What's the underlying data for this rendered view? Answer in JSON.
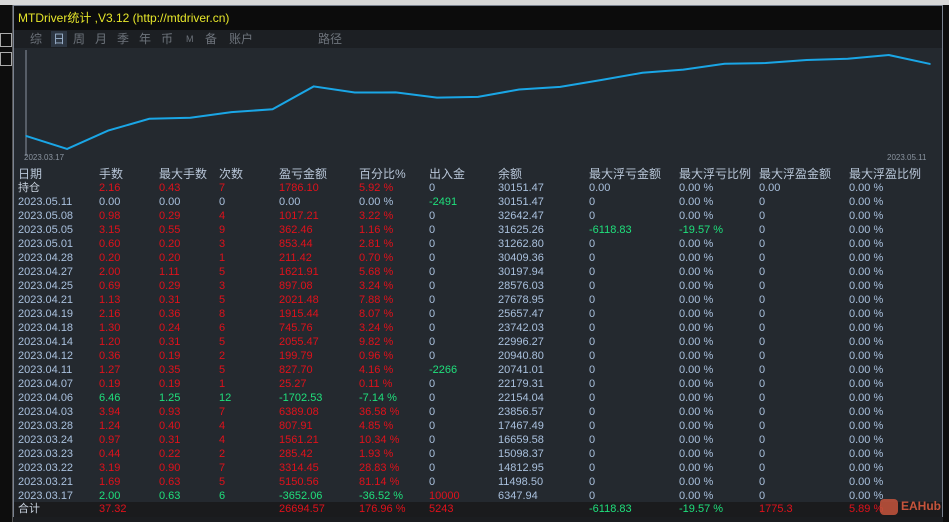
{
  "title": "MTDriver统计 ,V3.12 (http://mtdriver.cn)",
  "tabs": [
    "综",
    "日",
    "周",
    "月",
    "季",
    "年",
    "币",
    "M",
    "备",
    "账户",
    "路径"
  ],
  "active_tab": "日",
  "chart_data": {
    "type": "line",
    "title": "",
    "x_start_label": "2023.03.17",
    "x_end_label": "2023.05.11",
    "ylim": [
      5500,
      33500
    ],
    "grid": false,
    "values": [
      10000,
      6347.94,
      11498.5,
      14812.95,
      15098.37,
      16659.58,
      17467.49,
      23856.57,
      22154.04,
      22179.31,
      20741.01,
      20940.8,
      22996.27,
      23742.03,
      25657.47,
      27678.95,
      28576.03,
      30197.94,
      30409.36,
      31262.8,
      31625.26,
      32642.47,
      30151.47
    ],
    "line_color": "#1aa6e6"
  },
  "columns": [
    "日期",
    "手数",
    "最大手数",
    "次数",
    "盈亏金额",
    "百分比%",
    "出入金",
    "余额",
    "最大浮亏金额",
    "最大浮亏比例",
    "最大浮盈金额",
    "最大浮盈比例"
  ],
  "rows": [
    [
      "持仓",
      "2.16",
      "0.43",
      "7",
      "1786.10",
      "5.92 %",
      "0",
      "30151.47",
      "0.00",
      "0.00 %",
      "0.00",
      "0.00 %"
    ],
    [
      "2023.05.11",
      "0.00",
      "0.00",
      "0",
      "0.00",
      "0.00 %",
      "-2491",
      "30151.47",
      "0",
      "0.00 %",
      "0",
      "0.00 %"
    ],
    [
      "2023.05.08",
      "0.98",
      "0.29",
      "4",
      "1017.21",
      "3.22 %",
      "0",
      "32642.47",
      "0",
      "0.00 %",
      "0",
      "0.00 %"
    ],
    [
      "2023.05.05",
      "3.15",
      "0.55",
      "9",
      "362.46",
      "1.16 %",
      "0",
      "31625.26",
      "-6118.83",
      "-19.57 %",
      "0",
      "0.00 %"
    ],
    [
      "2023.05.01",
      "0.60",
      "0.20",
      "3",
      "853.44",
      "2.81 %",
      "0",
      "31262.80",
      "0",
      "0.00 %",
      "0",
      "0.00 %"
    ],
    [
      "2023.04.28",
      "0.20",
      "0.20",
      "1",
      "211.42",
      "0.70 %",
      "0",
      "30409.36",
      "0",
      "0.00 %",
      "0",
      "0.00 %"
    ],
    [
      "2023.04.27",
      "2.00",
      "1.11",
      "5",
      "1621.91",
      "5.68 %",
      "0",
      "30197.94",
      "0",
      "0.00 %",
      "0",
      "0.00 %"
    ],
    [
      "2023.04.25",
      "0.69",
      "0.29",
      "3",
      "897.08",
      "3.24 %",
      "0",
      "28576.03",
      "0",
      "0.00 %",
      "0",
      "0.00 %"
    ],
    [
      "2023.04.21",
      "1.13",
      "0.31",
      "5",
      "2021.48",
      "7.88 %",
      "0",
      "27678.95",
      "0",
      "0.00 %",
      "0",
      "0.00 %"
    ],
    [
      "2023.04.19",
      "2.16",
      "0.36",
      "8",
      "1915.44",
      "8.07 %",
      "0",
      "25657.47",
      "0",
      "0.00 %",
      "0",
      "0.00 %"
    ],
    [
      "2023.04.18",
      "1.30",
      "0.24",
      "6",
      "745.76",
      "3.24 %",
      "0",
      "23742.03",
      "0",
      "0.00 %",
      "0",
      "0.00 %"
    ],
    [
      "2023.04.14",
      "1.20",
      "0.31",
      "5",
      "2055.47",
      "9.82 %",
      "0",
      "22996.27",
      "0",
      "0.00 %",
      "0",
      "0.00 %"
    ],
    [
      "2023.04.12",
      "0.36",
      "0.19",
      "2",
      "199.79",
      "0.96 %",
      "0",
      "20940.80",
      "0",
      "0.00 %",
      "0",
      "0.00 %"
    ],
    [
      "2023.04.11",
      "1.27",
      "0.35",
      "5",
      "827.70",
      "4.16 %",
      "-2266",
      "20741.01",
      "0",
      "0.00 %",
      "0",
      "0.00 %"
    ],
    [
      "2023.04.07",
      "0.19",
      "0.19",
      "1",
      "25.27",
      "0.11 %",
      "0",
      "22179.31",
      "0",
      "0.00 %",
      "0",
      "0.00 %"
    ],
    [
      "2023.04.06",
      "6.46",
      "1.25",
      "12",
      "-1702.53",
      "-7.14 %",
      "0",
      "22154.04",
      "0",
      "0.00 %",
      "0",
      "0.00 %"
    ],
    [
      "2023.04.03",
      "3.94",
      "0.93",
      "7",
      "6389.08",
      "36.58 %",
      "0",
      "23856.57",
      "0",
      "0.00 %",
      "0",
      "0.00 %"
    ],
    [
      "2023.03.28",
      "1.24",
      "0.40",
      "4",
      "807.91",
      "4.85 %",
      "0",
      "17467.49",
      "0",
      "0.00 %",
      "0",
      "0.00 %"
    ],
    [
      "2023.03.24",
      "0.97",
      "0.31",
      "4",
      "1561.21",
      "10.34 %",
      "0",
      "16659.58",
      "0",
      "0.00 %",
      "0",
      "0.00 %"
    ],
    [
      "2023.03.23",
      "0.44",
      "0.22",
      "2",
      "285.42",
      "1.93 %",
      "0",
      "15098.37",
      "0",
      "0.00 %",
      "0",
      "0.00 %"
    ],
    [
      "2023.03.22",
      "3.19",
      "0.90",
      "7",
      "3314.45",
      "28.83 %",
      "0",
      "14812.95",
      "0",
      "0.00 %",
      "0",
      "0.00 %"
    ],
    [
      "2023.03.21",
      "1.69",
      "0.63",
      "5",
      "5150.56",
      "81.14 %",
      "0",
      "11498.50",
      "0",
      "0.00 %",
      "0",
      "0.00 %"
    ],
    [
      "2023.03.17",
      "2.00",
      "0.63",
      "6",
      "-3652.06",
      "-36.52 %",
      "10000",
      "6347.94",
      "0",
      "0.00 %",
      "0",
      "0.00 %"
    ]
  ],
  "total": {
    "label": "合计",
    "lots": "37.32",
    "pnl": "26694.57",
    "pct": "176.96 %",
    "flow": "5243",
    "max_float_loss": "-6118.83",
    "max_float_loss_pct": "-19.57 %",
    "max_float_profit": "1775.3",
    "max_float_profit_pct": "5.89 %"
  },
  "watermark": "EAHub",
  "colors": {
    "red": "#e0111b",
    "green": "#1fe07c",
    "text": "#a9c0dd",
    "bg": "#24292f"
  }
}
